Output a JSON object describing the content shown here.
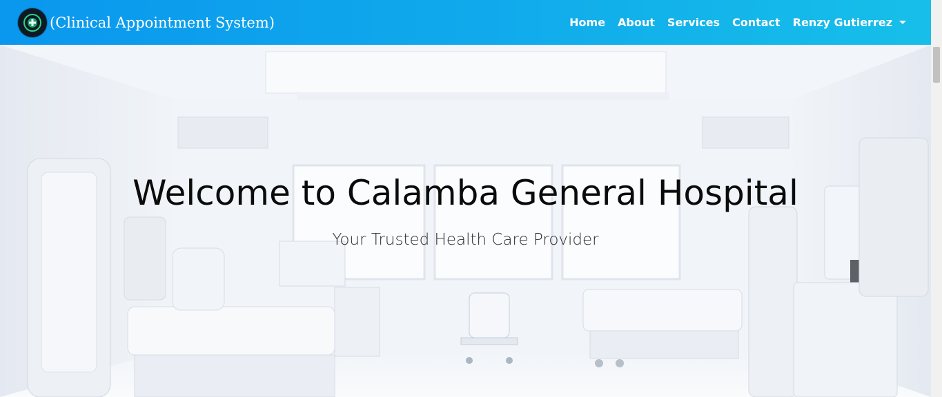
{
  "navbar": {
    "brand_text": "(Clinical Appointment System)",
    "logo_icon": "hospital-logo-icon",
    "links": [
      {
        "label": "Home"
      },
      {
        "label": "About"
      },
      {
        "label": "Services"
      },
      {
        "label": "Contact"
      }
    ],
    "user_menu": {
      "label": "Renzy Gutierrez",
      "icon": "caret-down-icon"
    },
    "colors": {
      "gradient_start": "#0a97ee",
      "gradient_end": "#16bfe9",
      "text": "#ffffff"
    }
  },
  "hero": {
    "title": "Welcome to Calamba General Hospital",
    "subtitle": "Your Trusted Health Care Provider",
    "background": "hospital-room-image"
  }
}
